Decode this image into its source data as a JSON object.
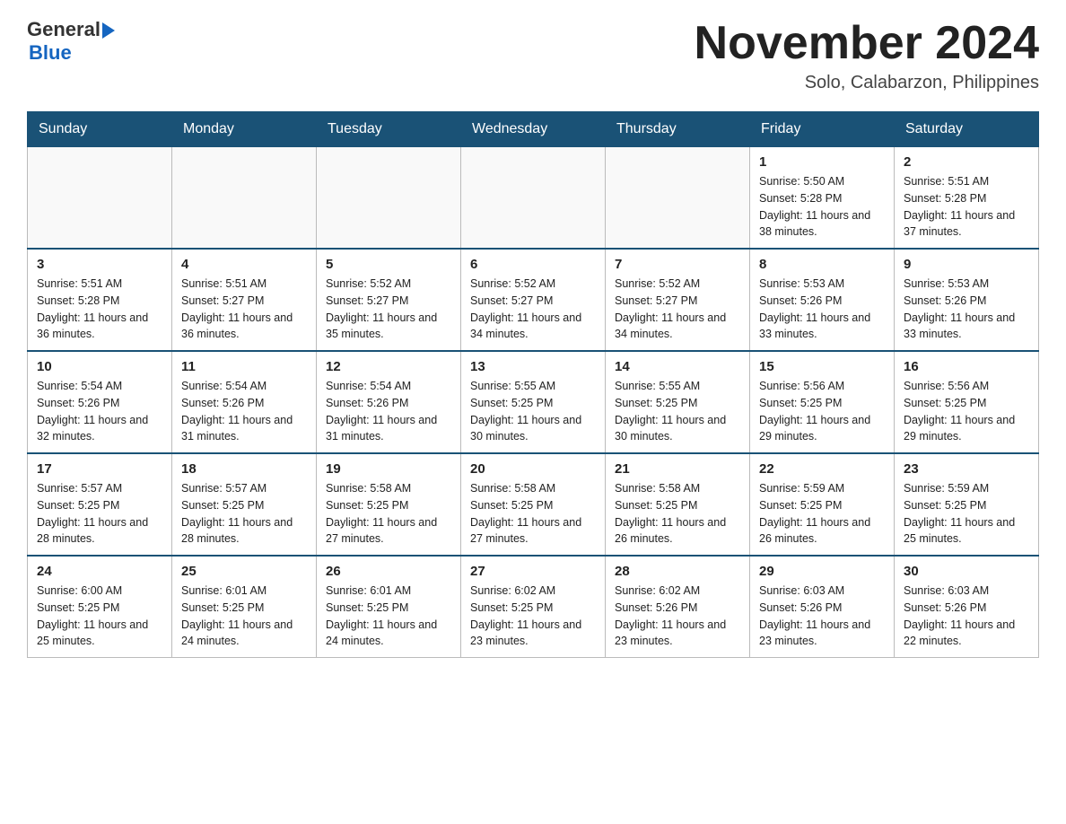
{
  "header": {
    "logo_general": "General",
    "logo_blue": "Blue",
    "month_year": "November 2024",
    "location": "Solo, Calabarzon, Philippines"
  },
  "days_of_week": [
    "Sunday",
    "Monday",
    "Tuesday",
    "Wednesday",
    "Thursday",
    "Friday",
    "Saturday"
  ],
  "weeks": [
    [
      {
        "day": "",
        "info": ""
      },
      {
        "day": "",
        "info": ""
      },
      {
        "day": "",
        "info": ""
      },
      {
        "day": "",
        "info": ""
      },
      {
        "day": "",
        "info": ""
      },
      {
        "day": "1",
        "info": "Sunrise: 5:50 AM\nSunset: 5:28 PM\nDaylight: 11 hours and 38 minutes."
      },
      {
        "day": "2",
        "info": "Sunrise: 5:51 AM\nSunset: 5:28 PM\nDaylight: 11 hours and 37 minutes."
      }
    ],
    [
      {
        "day": "3",
        "info": "Sunrise: 5:51 AM\nSunset: 5:28 PM\nDaylight: 11 hours and 36 minutes."
      },
      {
        "day": "4",
        "info": "Sunrise: 5:51 AM\nSunset: 5:27 PM\nDaylight: 11 hours and 36 minutes."
      },
      {
        "day": "5",
        "info": "Sunrise: 5:52 AM\nSunset: 5:27 PM\nDaylight: 11 hours and 35 minutes."
      },
      {
        "day": "6",
        "info": "Sunrise: 5:52 AM\nSunset: 5:27 PM\nDaylight: 11 hours and 34 minutes."
      },
      {
        "day": "7",
        "info": "Sunrise: 5:52 AM\nSunset: 5:27 PM\nDaylight: 11 hours and 34 minutes."
      },
      {
        "day": "8",
        "info": "Sunrise: 5:53 AM\nSunset: 5:26 PM\nDaylight: 11 hours and 33 minutes."
      },
      {
        "day": "9",
        "info": "Sunrise: 5:53 AM\nSunset: 5:26 PM\nDaylight: 11 hours and 33 minutes."
      }
    ],
    [
      {
        "day": "10",
        "info": "Sunrise: 5:54 AM\nSunset: 5:26 PM\nDaylight: 11 hours and 32 minutes."
      },
      {
        "day": "11",
        "info": "Sunrise: 5:54 AM\nSunset: 5:26 PM\nDaylight: 11 hours and 31 minutes."
      },
      {
        "day": "12",
        "info": "Sunrise: 5:54 AM\nSunset: 5:26 PM\nDaylight: 11 hours and 31 minutes."
      },
      {
        "day": "13",
        "info": "Sunrise: 5:55 AM\nSunset: 5:25 PM\nDaylight: 11 hours and 30 minutes."
      },
      {
        "day": "14",
        "info": "Sunrise: 5:55 AM\nSunset: 5:25 PM\nDaylight: 11 hours and 30 minutes."
      },
      {
        "day": "15",
        "info": "Sunrise: 5:56 AM\nSunset: 5:25 PM\nDaylight: 11 hours and 29 minutes."
      },
      {
        "day": "16",
        "info": "Sunrise: 5:56 AM\nSunset: 5:25 PM\nDaylight: 11 hours and 29 minutes."
      }
    ],
    [
      {
        "day": "17",
        "info": "Sunrise: 5:57 AM\nSunset: 5:25 PM\nDaylight: 11 hours and 28 minutes."
      },
      {
        "day": "18",
        "info": "Sunrise: 5:57 AM\nSunset: 5:25 PM\nDaylight: 11 hours and 28 minutes."
      },
      {
        "day": "19",
        "info": "Sunrise: 5:58 AM\nSunset: 5:25 PM\nDaylight: 11 hours and 27 minutes."
      },
      {
        "day": "20",
        "info": "Sunrise: 5:58 AM\nSunset: 5:25 PM\nDaylight: 11 hours and 27 minutes."
      },
      {
        "day": "21",
        "info": "Sunrise: 5:58 AM\nSunset: 5:25 PM\nDaylight: 11 hours and 26 minutes."
      },
      {
        "day": "22",
        "info": "Sunrise: 5:59 AM\nSunset: 5:25 PM\nDaylight: 11 hours and 26 minutes."
      },
      {
        "day": "23",
        "info": "Sunrise: 5:59 AM\nSunset: 5:25 PM\nDaylight: 11 hours and 25 minutes."
      }
    ],
    [
      {
        "day": "24",
        "info": "Sunrise: 6:00 AM\nSunset: 5:25 PM\nDaylight: 11 hours and 25 minutes."
      },
      {
        "day": "25",
        "info": "Sunrise: 6:01 AM\nSunset: 5:25 PM\nDaylight: 11 hours and 24 minutes."
      },
      {
        "day": "26",
        "info": "Sunrise: 6:01 AM\nSunset: 5:25 PM\nDaylight: 11 hours and 24 minutes."
      },
      {
        "day": "27",
        "info": "Sunrise: 6:02 AM\nSunset: 5:25 PM\nDaylight: 11 hours and 23 minutes."
      },
      {
        "day": "28",
        "info": "Sunrise: 6:02 AM\nSunset: 5:26 PM\nDaylight: 11 hours and 23 minutes."
      },
      {
        "day": "29",
        "info": "Sunrise: 6:03 AM\nSunset: 5:26 PM\nDaylight: 11 hours and 23 minutes."
      },
      {
        "day": "30",
        "info": "Sunrise: 6:03 AM\nSunset: 5:26 PM\nDaylight: 11 hours and 22 minutes."
      }
    ]
  ]
}
